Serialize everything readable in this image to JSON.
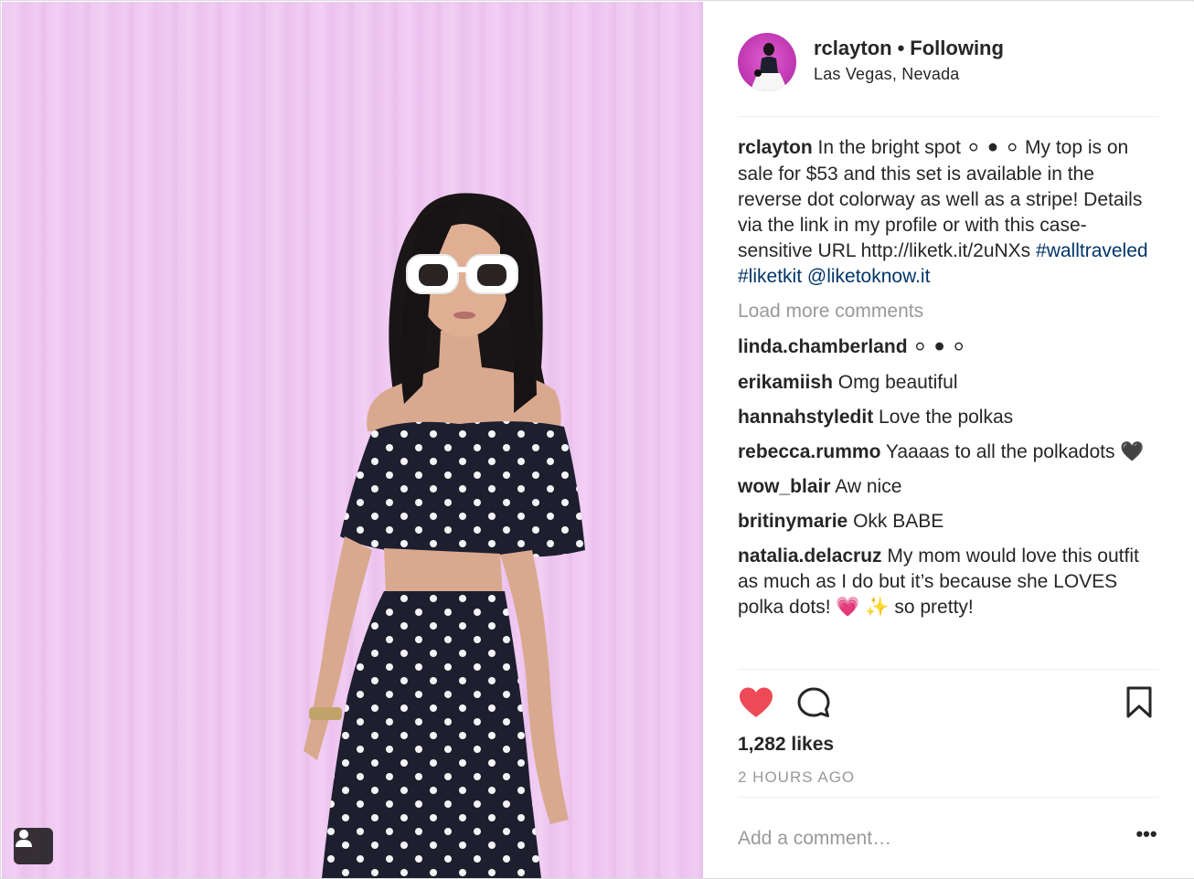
{
  "post": {
    "author": "rclayton",
    "follow_status": "Following",
    "location": "Las Vegas, Nevada",
    "caption": {
      "username": "rclayton",
      "text_1": "In the bright spot",
      "emoji": "⚪ ⚫ ⚪",
      "text_2": " My top is on sale for $53 and this set is available in the reverse dot colorway as well as a stripe! Details via the link in my profile or with this case-sensitive URL http://liketk.it/2uNXs ",
      "hashtag_1": "#walltraveled",
      "hashtag_2": "#liketkit",
      "mention": "@liketoknow.it"
    },
    "load_more": "Load more comments",
    "comments": [
      {
        "username": "linda.chamberland",
        "text": "⚪ ⚫ ⚪"
      },
      {
        "username": "erikamiish",
        "text": "Omg beautiful"
      },
      {
        "username": "hannahstyledit",
        "text": "Love the polkas"
      },
      {
        "username": "rebecca.rummo",
        "text": "Yaaaas to all the polkadots 🖤"
      },
      {
        "username": "wow_blair",
        "text": "Aw nice"
      },
      {
        "username": "britinymarie",
        "text": "Okk BABE"
      },
      {
        "username": "natalia.delacruz",
        "text": "My mom would love this outfit as much as I do but it’s because she LOVES polka dots! 💗 ✨  so pretty!"
      }
    ],
    "likes": "1,282 likes",
    "timestamp": "2 HOURS AGO",
    "comment_placeholder": "Add a comment…",
    "more_options": "•••",
    "liked": true
  },
  "colors": {
    "wall_pink": "#f0c9f2",
    "link_blue": "#003569",
    "heart_red": "#ed4956",
    "muted_gray": "#999999",
    "text_dark": "#262626"
  },
  "icons": {
    "like": "heart-filled-icon",
    "comment": "speech-bubble-icon",
    "save": "bookmark-icon",
    "tag": "person-tag-icon"
  }
}
